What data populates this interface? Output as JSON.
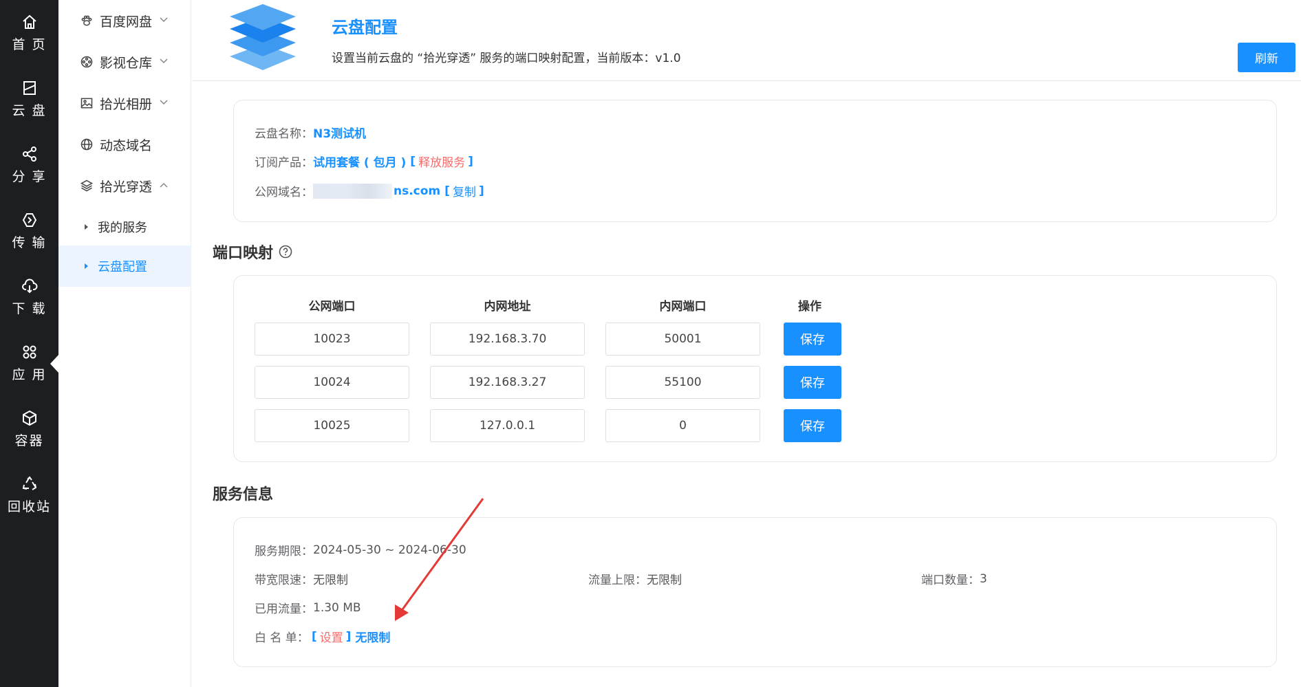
{
  "rail": {
    "items": [
      {
        "label": "首 页",
        "icon": "home-icon"
      },
      {
        "label": "云 盘",
        "icon": "cloud-disk-icon"
      },
      {
        "label": "分 享",
        "icon": "share-icon"
      },
      {
        "label": "传 输",
        "icon": "transfer-icon"
      },
      {
        "label": "下 载",
        "icon": "download-icon"
      },
      {
        "label": "应 用",
        "icon": "apps-icon"
      },
      {
        "label": "容器",
        "icon": "container-icon"
      },
      {
        "label": "回收站",
        "icon": "recycle-icon"
      }
    ],
    "active": "应 用"
  },
  "subnav": {
    "items": [
      {
        "label": "百度网盘",
        "icon": "paw-icon"
      },
      {
        "label": "影视仓库",
        "icon": "film-reel-icon"
      },
      {
        "label": "拾光相册",
        "icon": "image-icon"
      },
      {
        "label": "动态域名",
        "icon": "globe-icon"
      },
      {
        "label": "拾光穿透",
        "icon": "layers-icon"
      }
    ],
    "children": [
      {
        "label": "我的服务"
      },
      {
        "label": "云盘配置"
      }
    ],
    "active": "云盘配置"
  },
  "header": {
    "title": "云盘配置",
    "description": "设置当前云盘的 “拾光穿透” 服务的端口映射配置，当前版本：v1.0",
    "refresh_label": "刷新"
  },
  "info": {
    "name_key": "云盘名称：",
    "name_value": "N3测试机",
    "product_key": "订阅产品：",
    "product_value": "试用套餐 ( 包月 )",
    "release_label": "释放服务",
    "domain_key": "公网域名：",
    "domain_value": "ns.com",
    "copy_label": "复制"
  },
  "port_mapping": {
    "title": "端口映射",
    "headers": [
      "公网端口",
      "内网地址",
      "内网端口",
      "操作"
    ],
    "rows": [
      {
        "public_port": "10023",
        "address": "192.168.3.70",
        "private_port": "50001",
        "action": "保存"
      },
      {
        "public_port": "10024",
        "address": "192.168.3.27",
        "private_port": "55100",
        "action": "保存"
      },
      {
        "public_port": "10025",
        "address": "127.0.0.1",
        "private_port": "0",
        "action": "保存"
      }
    ]
  },
  "service": {
    "title": "服务信息",
    "period_key": "服务期限：",
    "period_value": "2024-05-30 ~ 2024-06-30",
    "bandwidth_key": "带宽限速：",
    "bandwidth_value": "无限制",
    "traffic_limit_key": "流量上限：",
    "traffic_limit_value": "无限制",
    "port_count_key": "端口数量：",
    "port_count_value": "3",
    "used_key": "已用流量：",
    "used_value": "1.30 MB",
    "whitelist_key": "白 名 单：",
    "whitelist_set": "设置",
    "whitelist_value": "无限制"
  },
  "colors": {
    "accent": "#1890ff",
    "danger": "#f56c6c",
    "rail_bg": "#1d1e21",
    "annotation_arrow": "#e53935"
  }
}
